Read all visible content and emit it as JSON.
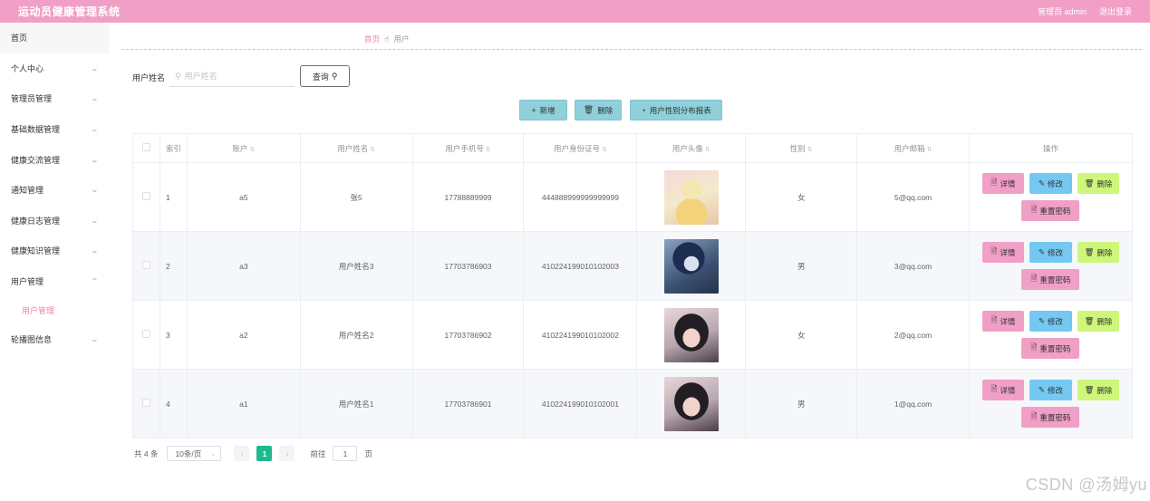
{
  "app": {
    "title": "运动员健康管理系统",
    "admin_label": "管理员 admin",
    "logout": "退出登录"
  },
  "sidebar": {
    "items": [
      {
        "label": "首页",
        "expandable": false
      },
      {
        "label": "个人中心",
        "expandable": true
      },
      {
        "label": "管理员管理",
        "expandable": true
      },
      {
        "label": "基础数据管理",
        "expandable": true
      },
      {
        "label": "健康交流管理",
        "expandable": true
      },
      {
        "label": "通知管理",
        "expandable": true
      },
      {
        "label": "健康日志管理",
        "expandable": true
      },
      {
        "label": "健康知识管理",
        "expandable": true
      },
      {
        "label": "用户管理",
        "expandable": true,
        "open": true
      },
      {
        "label": "轮播图信息",
        "expandable": true
      }
    ],
    "sub_item": "用户管理"
  },
  "breadcrumb": {
    "home": "首页",
    "current": "用户"
  },
  "search": {
    "label": "用户姓名",
    "placeholder": "用户姓名",
    "button": "查询"
  },
  "actions": {
    "add": "新增",
    "delete": "删除",
    "report": "用户性别分布报表"
  },
  "table": {
    "headers": {
      "index": "索引",
      "account": "账户",
      "name": "用户姓名",
      "phone": "用户手机号",
      "id_card": "用户身份证号",
      "avatar": "用户头像",
      "gender": "性别",
      "email": "用户邮箱",
      "ops": "操作"
    },
    "rows": [
      {
        "index": "1",
        "account": "a5",
        "name": "张5",
        "phone": "17788889999",
        "id_card": "444888999999999999",
        "gender": "女",
        "email": "5@qq.com"
      },
      {
        "index": "2",
        "account": "a3",
        "name": "用户姓名3",
        "phone": "17703786903",
        "id_card": "410224199010102003",
        "gender": "男",
        "email": "3@qq.com"
      },
      {
        "index": "3",
        "account": "a2",
        "name": "用户姓名2",
        "phone": "17703786902",
        "id_card": "410224199010102002",
        "gender": "女",
        "email": "2@qq.com"
      },
      {
        "index": "4",
        "account": "a1",
        "name": "用户姓名1",
        "phone": "17703786901",
        "id_card": "410224199010102001",
        "gender": "男",
        "email": "1@qq.com"
      }
    ],
    "ops": {
      "detail": "详情",
      "edit": "修改",
      "delete": "删除",
      "reset": "重置密码"
    }
  },
  "pagination": {
    "total": "共 4 条",
    "page_size": "10条/页",
    "current": "1",
    "goto_label": "前往",
    "goto_value": "1",
    "page_suffix": "页"
  },
  "watermark": "CSDN @汤姆yu",
  "colors": {
    "topbar": "#f19fc6",
    "accent_pink": "#f07fb2",
    "action_teal": "#8fd0da",
    "edit_blue": "#74c8f2",
    "delete_green": "#cdf67a",
    "pager_active": "#1fb98f"
  }
}
